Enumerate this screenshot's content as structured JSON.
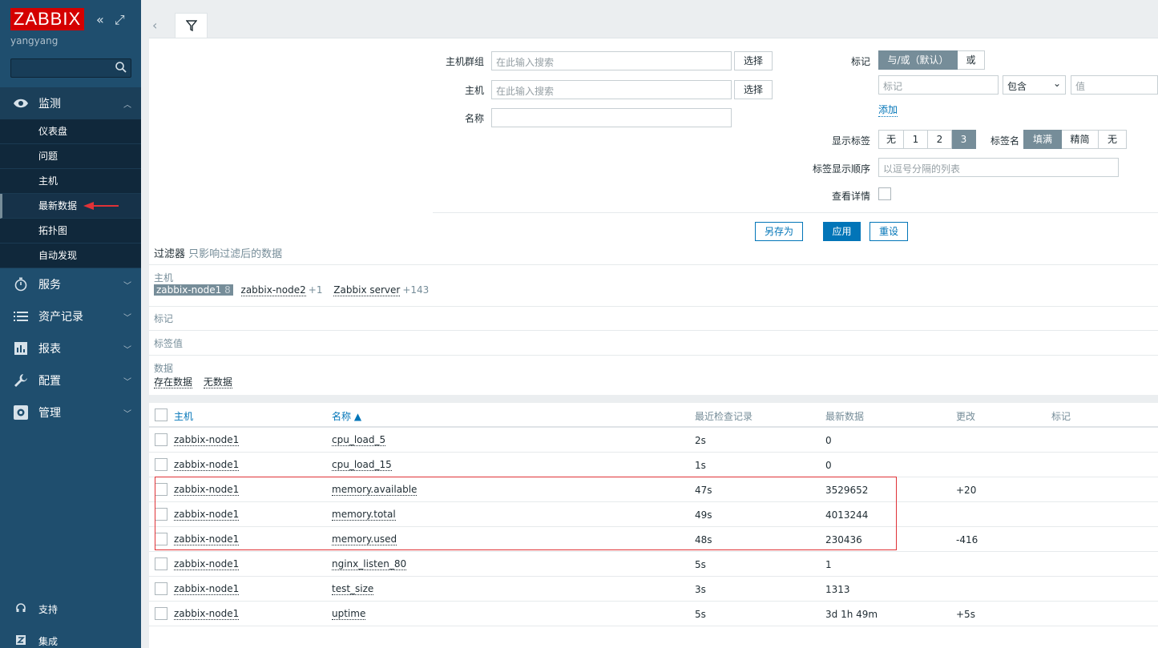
{
  "sidebar": {
    "logo": "ZABBIX",
    "username": "yangyang",
    "nav": [
      {
        "label": "监测"
      },
      {
        "label": "服务"
      },
      {
        "label": "资产记录"
      },
      {
        "label": "报表"
      },
      {
        "label": "配置"
      },
      {
        "label": "管理"
      }
    ],
    "monitoring_sub": [
      "仪表盘",
      "问题",
      "主机",
      "最新数据",
      "拓扑图",
      "自动发现"
    ],
    "bottom": [
      {
        "label": "支持"
      },
      {
        "label": "集成"
      }
    ]
  },
  "filter": {
    "host_group_label": "主机群组",
    "host_label": "主机",
    "name_label": "名称",
    "search_placeholder": "在此输入搜索",
    "select_btn": "选择",
    "tags_label": "标记",
    "tag_op_andor": "与/或（默认）",
    "tag_op_or": "或",
    "tag_placeholder": "标记",
    "tag_operator": "包含",
    "value_placeholder": "值",
    "add_link": "添加",
    "show_tags_label": "显示标签",
    "show_tags_opts": [
      "无",
      "1",
      "2",
      "3"
    ],
    "tag_name_label": "标签名",
    "tag_name_opts": [
      "填满",
      "精简",
      "无"
    ],
    "tag_order_label": "标签显示顺序",
    "tag_order_placeholder": "以逗号分隔的列表",
    "details_label": "查看详情",
    "save_as": "另存为",
    "apply": "应用",
    "reset": "重设"
  },
  "summary": {
    "title": "过滤器",
    "subtitle": "只影响过滤后的数据",
    "host_label": "主机",
    "hosts": [
      {
        "name": "zabbix-node1",
        "count": "8",
        "selected": true
      },
      {
        "name": "zabbix-node2",
        "count": "+1"
      },
      {
        "name": "Zabbix server",
        "count": "+143"
      }
    ],
    "tags_label": "标记",
    "tag_values_label": "标签值",
    "data_label": "数据",
    "data_links": [
      "存在数据",
      "无数据"
    ]
  },
  "table": {
    "headers": {
      "host": "主机",
      "name": "名称 ▲",
      "last_check": "最近检查记录",
      "last_value": "最新数据",
      "change": "更改",
      "tags": "标记"
    },
    "rows": [
      {
        "host": "zabbix-node1",
        "name": "cpu_load_5",
        "last_check": "2s",
        "last_value": "0",
        "change": ""
      },
      {
        "host": "zabbix-node1",
        "name": "cpu_load_15",
        "last_check": "1s",
        "last_value": "0",
        "change": ""
      },
      {
        "host": "zabbix-node1",
        "name": "memory.available",
        "last_check": "47s",
        "last_value": "3529652",
        "change": "+20"
      },
      {
        "host": "zabbix-node1",
        "name": "memory.total",
        "last_check": "49s",
        "last_value": "4013244",
        "change": ""
      },
      {
        "host": "zabbix-node1",
        "name": "memory.used",
        "last_check": "48s",
        "last_value": "230436",
        "change": "-416"
      },
      {
        "host": "zabbix-node1",
        "name": "nginx_listen_80",
        "last_check": "5s",
        "last_value": "1",
        "change": ""
      },
      {
        "host": "zabbix-node1",
        "name": "test_size",
        "last_check": "3s",
        "last_value": "1313",
        "change": ""
      },
      {
        "host": "zabbix-node1",
        "name": "uptime",
        "last_check": "5s",
        "last_value": "3d 1h 49m",
        "change": "+5s"
      }
    ]
  },
  "colors": {
    "sidebar": "#1f4e6e",
    "accent": "#0275b8",
    "logo": "#d40000",
    "highlight": "#e03237"
  }
}
